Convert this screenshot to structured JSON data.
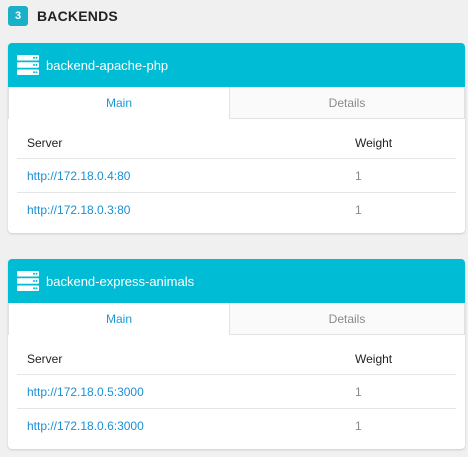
{
  "section": {
    "count": "3",
    "title": "BACKENDS"
  },
  "accent_color": "#00bcd4",
  "link_color": "#1a8fd6",
  "backends": [
    {
      "icon": "server-icon",
      "name": "backend-apache-php",
      "tabs": {
        "main": "Main",
        "details": "Details"
      },
      "columns": {
        "server": "Server",
        "weight": "Weight"
      },
      "servers": [
        {
          "url": "http://172.18.0.4:80",
          "weight": "1"
        },
        {
          "url": "http://172.18.0.3:80",
          "weight": "1"
        }
      ]
    },
    {
      "icon": "server-icon",
      "name": "backend-express-animals",
      "tabs": {
        "main": "Main",
        "details": "Details"
      },
      "columns": {
        "server": "Server",
        "weight": "Weight"
      },
      "servers": [
        {
          "url": "http://172.18.0.5:3000",
          "weight": "1"
        },
        {
          "url": "http://172.18.0.6:3000",
          "weight": "1"
        }
      ]
    }
  ]
}
